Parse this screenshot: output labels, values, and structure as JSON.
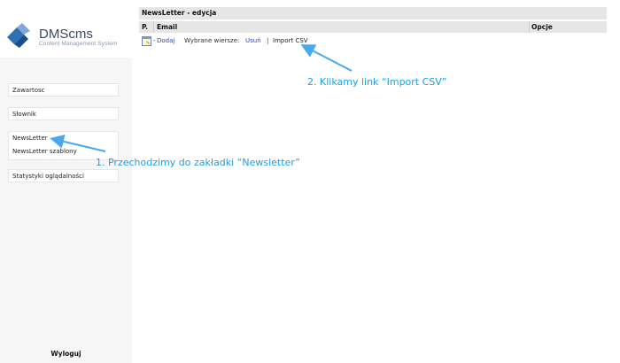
{
  "logo": {
    "title": "DMScms",
    "subtitle": "Content Management System",
    "icon": "dmscms-logo-icon"
  },
  "sidebar": {
    "items": [
      {
        "label": "Zawartosc"
      },
      {
        "label": "Słownik"
      },
      {
        "label": "NewsLetter"
      },
      {
        "label": "NewsLetter szablony"
      },
      {
        "label": "Statystyki oglądalności"
      }
    ],
    "logout_label": "Wyloguj"
  },
  "main": {
    "title": "NewsLetter - edycja",
    "columns": {
      "p": "P.",
      "email": "Email",
      "options": "Opcje"
    },
    "toolbar": {
      "dash": "-",
      "add_label": "Dodaj",
      "add_icon": "add-document-icon",
      "selected_rows_label": "Wybrane wiersze:",
      "delete_label": "Usuń",
      "separator": "|",
      "import_label": "Import CSV"
    }
  },
  "annotations": {
    "step1": "1. Przechodzimy do zakładki “Newsletter”",
    "step2": "2. Klikamy link “Import CSV”",
    "color": "#1f9ee6"
  }
}
